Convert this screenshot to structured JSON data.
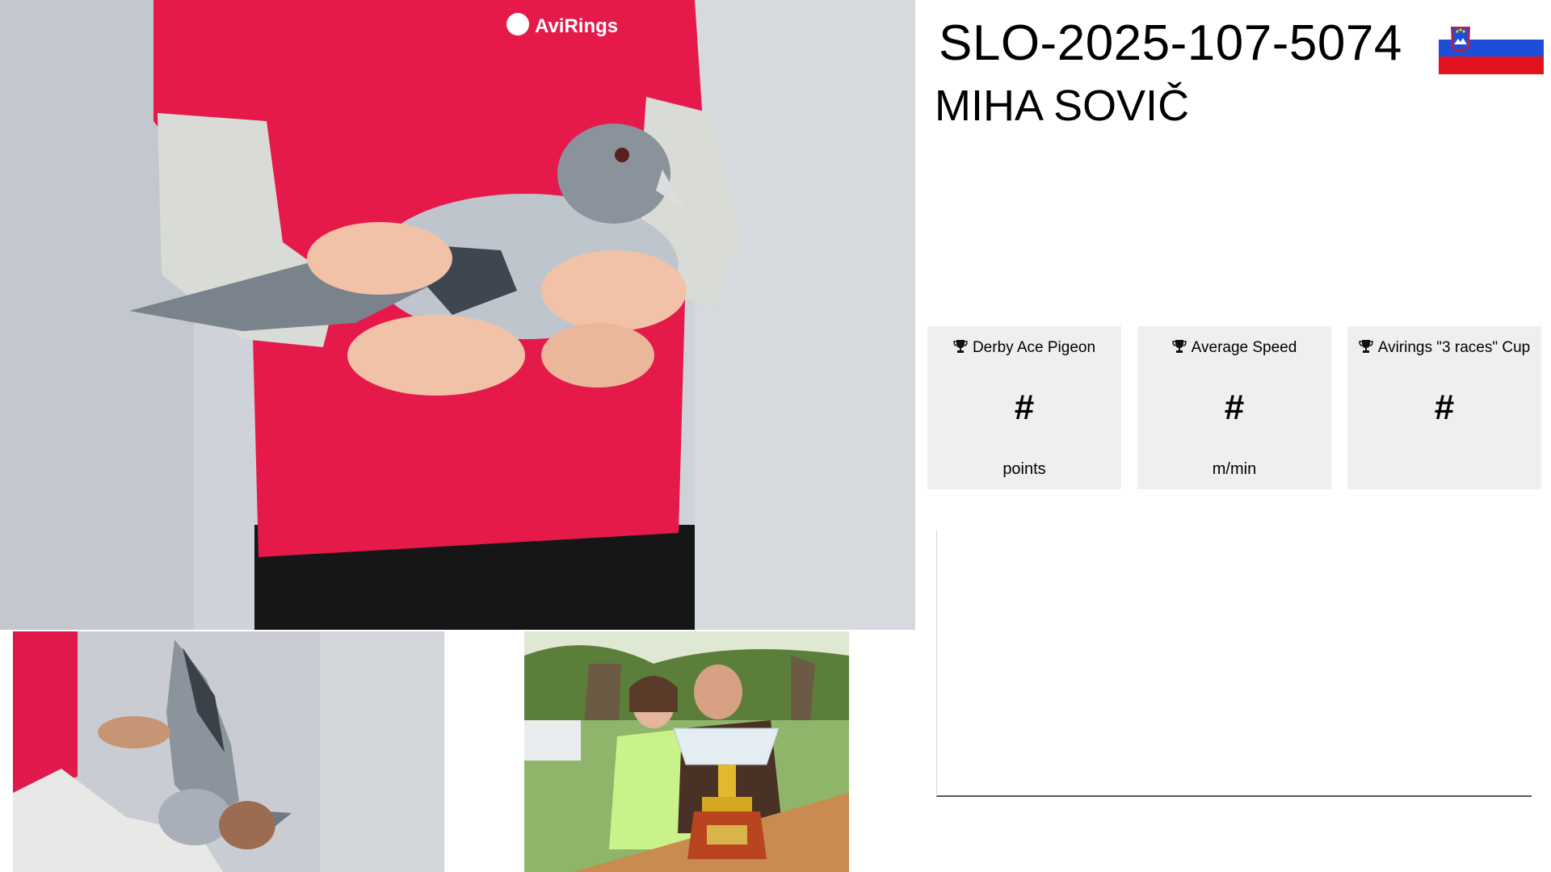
{
  "header": {
    "ring_number": "SLO-2025-107-5074",
    "owner_name": "MIHA SOVIČ",
    "country_flag": {
      "icon": "slovenia-flag-icon",
      "colors": [
        "#ffffff",
        "#1d4ed8",
        "#e1131f"
      ]
    }
  },
  "photos": {
    "main": {
      "icon": "pigeon-held-photo",
      "shirt_logo": "AviRings"
    },
    "wing": {
      "icon": "pigeon-wing-photo"
    },
    "owners": {
      "icon": "owners-with-trophy-photo"
    }
  },
  "stats": [
    {
      "title": "Derby Ace Pigeon",
      "value": "#",
      "unit": "points",
      "icon": "trophy-icon"
    },
    {
      "title": "Average Speed",
      "value": "#",
      "unit": "m/min",
      "icon": "trophy-icon"
    },
    {
      "title": "Avirings \"3 races\" Cup",
      "value": "#",
      "unit": "",
      "icon": "trophy-icon"
    }
  ],
  "colors": {
    "card_background": "#efefef",
    "shirt_red": "#e8184a"
  }
}
